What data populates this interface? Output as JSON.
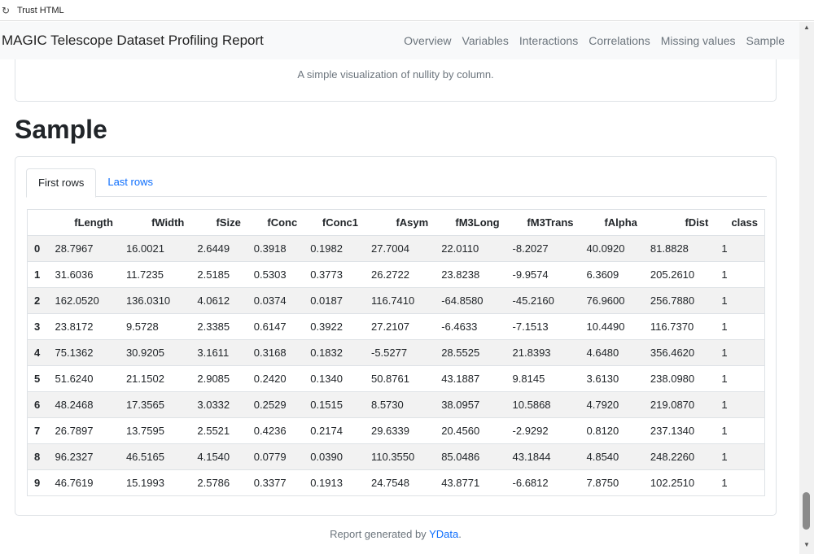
{
  "window": {
    "title": "Trust HTML"
  },
  "navbar": {
    "brand": "MAGIC Telescope Dataset Profiling Report",
    "links": [
      "Overview",
      "Variables",
      "Interactions",
      "Correlations",
      "Missing values",
      "Sample"
    ]
  },
  "missing_card": {
    "caption": "A simple visualization of nullity by column."
  },
  "sample": {
    "title": "Sample",
    "tabs": [
      "First rows",
      "Last rows"
    ],
    "active_tab": "First rows",
    "columns": [
      "",
      "fLength",
      "fWidth",
      "fSize",
      "fConc",
      "fConc1",
      "fAsym",
      "fM3Long",
      "fM3Trans",
      "fAlpha",
      "fDist",
      "class"
    ],
    "rows": [
      [
        "0",
        "28.7967",
        "16.0021",
        "2.6449",
        "0.3918",
        "0.1982",
        "27.7004",
        "22.0110",
        "-8.2027",
        "40.0920",
        "81.8828",
        "1"
      ],
      [
        "1",
        "31.6036",
        "11.7235",
        "2.5185",
        "0.5303",
        "0.3773",
        "26.2722",
        "23.8238",
        "-9.9574",
        "6.3609",
        "205.2610",
        "1"
      ],
      [
        "2",
        "162.0520",
        "136.0310",
        "4.0612",
        "0.0374",
        "0.0187",
        "116.7410",
        "-64.8580",
        "-45.2160",
        "76.9600",
        "256.7880",
        "1"
      ],
      [
        "3",
        "23.8172",
        "9.5728",
        "2.3385",
        "0.6147",
        "0.3922",
        "27.2107",
        "-6.4633",
        "-7.1513",
        "10.4490",
        "116.7370",
        "1"
      ],
      [
        "4",
        "75.1362",
        "30.9205",
        "3.1611",
        "0.3168",
        "0.1832",
        "-5.5277",
        "28.5525",
        "21.8393",
        "4.6480",
        "356.4620",
        "1"
      ],
      [
        "5",
        "51.6240",
        "21.1502",
        "2.9085",
        "0.2420",
        "0.1340",
        "50.8761",
        "43.1887",
        "9.8145",
        "3.6130",
        "238.0980",
        "1"
      ],
      [
        "6",
        "48.2468",
        "17.3565",
        "3.0332",
        "0.2529",
        "0.1515",
        "8.5730",
        "38.0957",
        "10.5868",
        "4.7920",
        "219.0870",
        "1"
      ],
      [
        "7",
        "26.7897",
        "13.7595",
        "2.5521",
        "0.4236",
        "0.2174",
        "29.6339",
        "20.4560",
        "-2.9292",
        "0.8120",
        "237.1340",
        "1"
      ],
      [
        "8",
        "96.2327",
        "46.5165",
        "4.1540",
        "0.0779",
        "0.0390",
        "110.3550",
        "85.0486",
        "43.1844",
        "4.8540",
        "248.2260",
        "1"
      ],
      [
        "9",
        "46.7619",
        "15.1993",
        "2.5786",
        "0.3377",
        "0.1913",
        "24.7548",
        "43.8771",
        "-6.6812",
        "7.8750",
        "102.2510",
        "1"
      ]
    ]
  },
  "footer": {
    "prefix": "Report generated by ",
    "link": "YData",
    "suffix": "."
  },
  "icons": {
    "reload": "reload-icon",
    "scroll_up": "scroll-up-arrow-icon",
    "scroll_down": "scroll-down-arrow-icon"
  },
  "colors": {
    "link": "#0d6efd",
    "muted": "#6c757d",
    "navbar_bg": "#f8f9fa",
    "stripe": "#f2f2f2"
  }
}
